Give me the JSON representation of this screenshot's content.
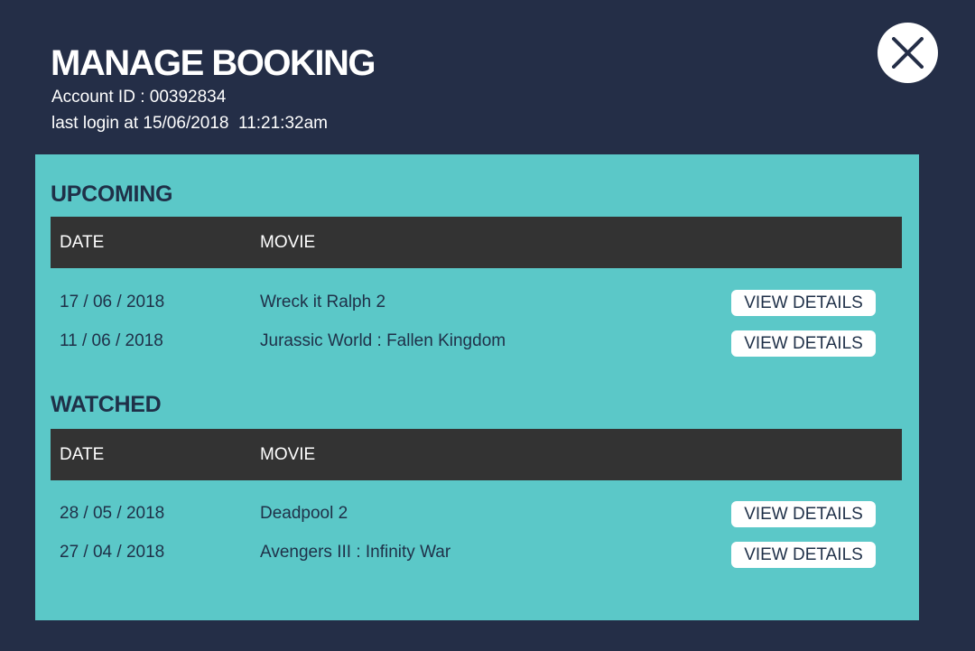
{
  "header": {
    "title": "MANAGE BOOKING",
    "account_id": "Account ID : 00392834",
    "last_login": "last login at 15/06/2018  11:21:32am",
    "close_icon": "close-icon"
  },
  "colors": {
    "background": "#242e47",
    "panel": "#5bc8c8",
    "table_header": "#333333",
    "text_dark": "#1f3048",
    "button": "#ffffff"
  },
  "upcoming": {
    "title": "UPCOMING",
    "columns": [
      "DATE",
      "MOVIE"
    ],
    "rows": [
      {
        "date": "17 / 06 / 2018",
        "movie": "Wreck it Ralph 2",
        "action": "VIEW DETAILS"
      },
      {
        "date": "11 / 06 / 2018",
        "movie": "Jurassic World : Fallen Kingdom",
        "action": "VIEW DETAILS"
      }
    ]
  },
  "watched": {
    "title": "WATCHED",
    "columns": [
      "DATE",
      "MOVIE"
    ],
    "rows": [
      {
        "date": "28 / 05 / 2018",
        "movie": "Deadpool 2",
        "action": "VIEW DETAILS"
      },
      {
        "date": "27 / 04 / 2018",
        "movie": "Avengers III : Infinity War",
        "action": "VIEW DETAILS"
      }
    ]
  }
}
